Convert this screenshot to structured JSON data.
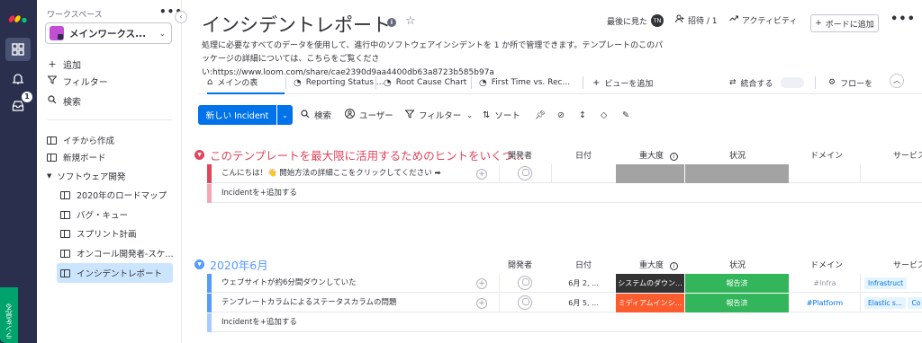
{
  "rail": {
    "plans_label": "ランを見る",
    "inbox_badge": "1"
  },
  "sidebar": {
    "workspace_label": "ワークスペース",
    "workspace_name": "メインワークス...",
    "actions": [
      {
        "label": "追加",
        "icon": "plus-icon"
      },
      {
        "label": "フィルター",
        "icon": "filter-icon"
      },
      {
        "label": "検索",
        "icon": "search-icon"
      }
    ],
    "items": [
      {
        "label": "イチから作成"
      },
      {
        "label": "新規ボード"
      },
      {
        "label": "ソフトウェア開発"
      },
      {
        "label": "2020年のロードマップ"
      },
      {
        "label": "バグ・キュー"
      },
      {
        "label": "スプリント計画"
      },
      {
        "label": "オンコール開発者-スケ..."
      },
      {
        "label": "インシデントレポート"
      }
    ]
  },
  "header": {
    "title": "インシデントレポート",
    "last_seen_label": "最後に見た",
    "avatar_initials": "TN",
    "invite_label": "招待 / 1",
    "activity_label": "アクティビティ",
    "add_board_label": "ボードに追加",
    "description": "処理に必要なすべてのデータを使用して、進行中のソフトウェアインシデントを 1 か所で管理できます。テンプレートのこのパッケージの詳細については、こちらをご覧ください:https://www.loom.com/share/cae2390d9aa4400db63a8723b585b97a"
  },
  "tabs": {
    "items": [
      {
        "label": "メインの表"
      },
      {
        "label": "Reporting Status ..."
      },
      {
        "label": "Root Cause Chart"
      },
      {
        "label": "First Time vs. Rec..."
      }
    ],
    "add_view_label": "ビューを追加",
    "integrate_label": "統合する",
    "flow_label": "フローを"
  },
  "toolbar": {
    "new_label": "新しい Incident",
    "search_label": "検索",
    "user_label": "ユーザー",
    "filter_label": "フィルター",
    "sort_label": "ソート"
  },
  "columns": [
    "開発者",
    "日付",
    "重大度",
    "状況",
    "ドメイン",
    "サービス"
  ],
  "groups": [
    {
      "title": "このテンプレートを最大限に活用するためのヒントをいくつ...",
      "color": "#e2445c",
      "rows": [
        {
          "name": "こんにちは！👋 開始方法の詳細ここをクリックしてください ➡",
          "date": "",
          "severity": "",
          "status": "",
          "domain": "",
          "service": ""
        }
      ],
      "add_label": "Incidentを+追加する"
    },
    {
      "title": "2020年6月",
      "color": "#579bfc",
      "rows": [
        {
          "name": "ウェブサイトが約6分間ダウンしていた",
          "date": "6月 2, ...",
          "severity": "システムのダウン...",
          "status": "報告済",
          "domain": "#Infra",
          "service": "Infrastruct"
        },
        {
          "name": "テンプレートカラムによるステータスカラムの問題",
          "date": "6月 5, ...",
          "severity": "ミディアムインシ...",
          "status": "報告済",
          "domain": "#Platform",
          "service": "Elastic s..."
        }
      ],
      "extra_service_tag": "Co",
      "add_label": "Incidentを+追加する"
    }
  ],
  "colors": {
    "accent": "#0073ea",
    "rail": "#292f4c",
    "severity_critical": "#333333",
    "severity_medium": "#fd5c2f",
    "status_reported": "#33b55b",
    "empty_cell": "#a3a3a3"
  }
}
